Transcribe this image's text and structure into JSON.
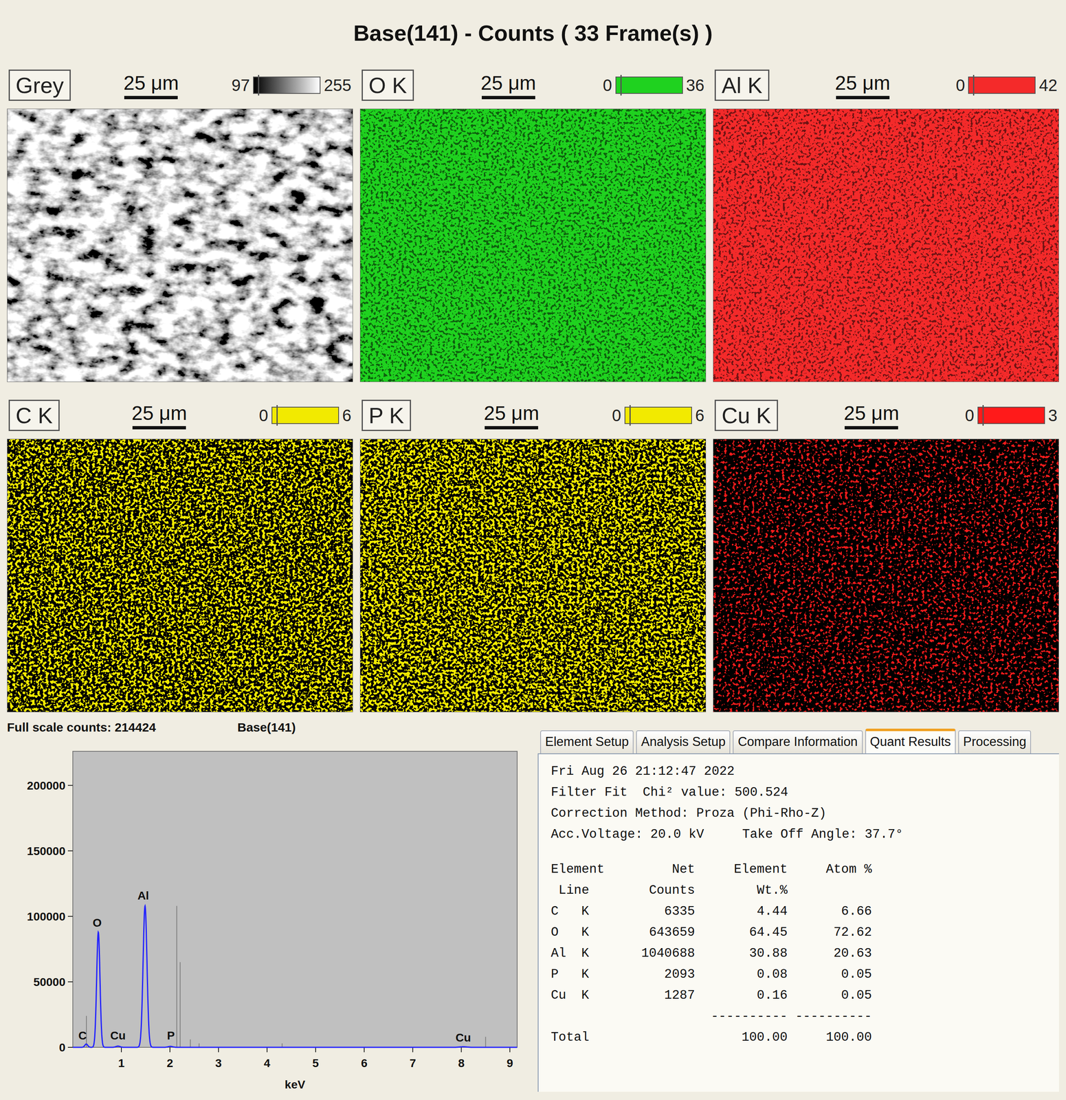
{
  "window": {
    "title": "Base(141) - Counts ( 33 Frame(s) )"
  },
  "maps": [
    {
      "label": "Grey",
      "scale": "25 μm",
      "min": "97",
      "max": "255",
      "kind": "grey",
      "color": "#ffffff",
      "density": 0.5
    },
    {
      "label": "O K",
      "scale": "25 μm",
      "min": "0",
      "max": "36",
      "kind": "dense",
      "color": "#1fd21f",
      "density": 0.3
    },
    {
      "label": "Al K",
      "scale": "25 μm",
      "min": "0",
      "max": "42",
      "kind": "dense",
      "color": "#f42a2a",
      "density": 0.25
    },
    {
      "label": "C K",
      "scale": "25 μm",
      "min": "0",
      "max": "6",
      "kind": "sparse",
      "color": "#f2ea00",
      "density": 0.45
    },
    {
      "label": "P K",
      "scale": "25 μm",
      "min": "0",
      "max": "6",
      "kind": "sparse",
      "color": "#f2ea00",
      "density": 0.5
    },
    {
      "label": "Cu K",
      "scale": "25 μm",
      "min": "0",
      "max": "3",
      "kind": "sparse",
      "color": "#ff1a1a",
      "density": 0.18
    }
  ],
  "spectrum": {
    "full_scale": "Full scale counts: 214424",
    "name": "Base(141)",
    "x_label": "keV",
    "x_ticks": [
      "1",
      "2",
      "3",
      "4",
      "5",
      "6",
      "7",
      "8",
      "9"
    ],
    "y_ticks": [
      "0",
      "50000",
      "100000",
      "150000",
      "200000"
    ],
    "x_max": 9.15,
    "y_max": 226000,
    "series": [
      {
        "name": "fit",
        "color": "#2323ff",
        "peaks": [
          [
            0.277,
            2500,
            0.03
          ],
          [
            0.525,
            88000,
            0.034
          ],
          [
            0.93,
            900,
            0.04
          ],
          [
            1.487,
            108000,
            0.04
          ],
          [
            2.01,
            700,
            0.045
          ],
          [
            8.04,
            400,
            0.07
          ]
        ]
      }
    ],
    "markers": [
      {
        "energy": 0.28,
        "counts": 24000
      },
      {
        "energy": 2.14,
        "counts": 108000
      },
      {
        "energy": 2.21,
        "counts": 65000
      },
      {
        "energy": 2.42,
        "counts": 6000
      },
      {
        "energy": 2.6,
        "counts": 3000
      },
      {
        "energy": 4.31,
        "counts": 3000
      },
      {
        "energy": 8.5,
        "counts": 8000
      }
    ],
    "peak_labels": [
      {
        "text": "C",
        "energy": 0.2,
        "counts": 6000
      },
      {
        "text": "O",
        "energy": 0.5,
        "counts": 92000
      },
      {
        "text": "Cu",
        "energy": 0.93,
        "counts": 6000
      },
      {
        "text": "Al",
        "energy": 1.45,
        "counts": 113000
      },
      {
        "text": "P",
        "energy": 2.02,
        "counts": 6000
      },
      {
        "text": "Cu",
        "energy": 8.04,
        "counts": 4500
      }
    ]
  },
  "quant": {
    "tabs": [
      {
        "label": "Element Setup",
        "selected": false
      },
      {
        "label": "Analysis Setup",
        "selected": false
      },
      {
        "label": "Compare Information",
        "selected": false
      },
      {
        "label": "Quant Results",
        "selected": true
      },
      {
        "label": "Processing",
        "selected": false
      }
    ],
    "lines": [
      "Fri Aug 26 21:12:47 2022",
      "Filter Fit  Chi² value: 500.524",
      "Correction Method: Proza (Phi-Rho-Z)",
      "Acc.Voltage: 20.0 kV     Take Off Angle: 37.7°"
    ],
    "columns": [
      [
        "Element",
        " Line"
      ],
      [
        "Net",
        "Counts"
      ],
      [
        "Element",
        "Wt.%"
      ],
      [
        "Atom %"
      ]
    ],
    "rows": [
      {
        "element": "C",
        "line": "K",
        "counts": "6335",
        "wt": "4.44",
        "atom": "6.66"
      },
      {
        "element": "O",
        "line": "K",
        "counts": "643659",
        "wt": "64.45",
        "atom": "72.62"
      },
      {
        "element": "Al",
        "line": "K",
        "counts": "1040688",
        "wt": "30.88",
        "atom": "20.63"
      },
      {
        "element": "P",
        "line": "K",
        "counts": "2093",
        "wt": "0.08",
        "atom": "0.05"
      },
      {
        "element": "Cu",
        "line": "K",
        "counts": "1287",
        "wt": "0.16",
        "atom": "0.05"
      }
    ],
    "separator": "----------",
    "total": {
      "label": "Total",
      "wt": "100.00",
      "atom": "100.00"
    }
  }
}
